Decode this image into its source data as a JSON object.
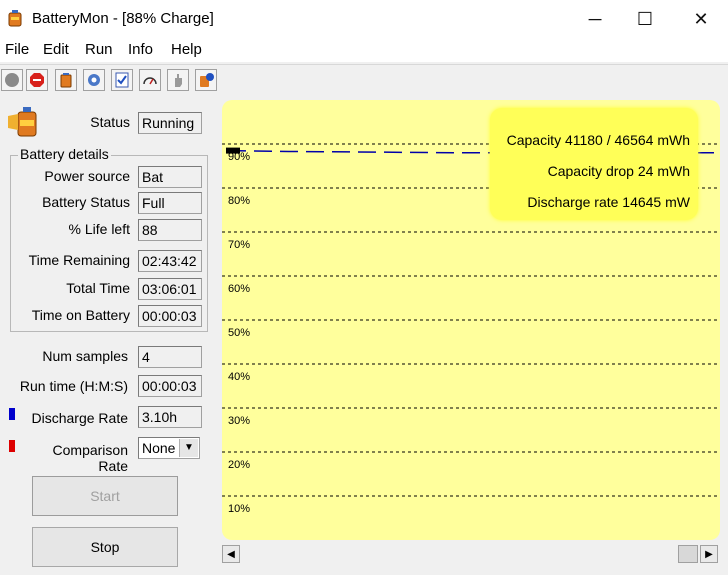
{
  "window": {
    "title": "BatteryMon - [88% Charge]",
    "buttons": {
      "minimize": "─",
      "maximize": "☐",
      "close": "✕"
    }
  },
  "menu": [
    "File",
    "Edit",
    "Run",
    "Info",
    "Help"
  ],
  "toolbar": {
    "icons": [
      "record-icon",
      "stop-icon",
      "battery-icon",
      "settings-icon",
      "checklist-icon",
      "gauge-icon",
      "hand-icon",
      "help-icon"
    ]
  },
  "status": {
    "label": "Status",
    "value": "Running"
  },
  "battery_details": {
    "title": "Battery details",
    "rows": [
      {
        "label": "Power source",
        "value": "Bat"
      },
      {
        "label": "Battery Status",
        "value": "Full"
      },
      {
        "label": "% Life left",
        "value": "88"
      },
      {
        "label": "Time Remaining",
        "value": "02:43:42"
      },
      {
        "label": "Total Time",
        "value": "03:06:01"
      },
      {
        "label": "Time on Battery",
        "value": "00:00:03"
      }
    ]
  },
  "num_samples": {
    "label": "Num samples",
    "value": "4"
  },
  "run_time": {
    "label": "Run time (H:M:S)",
    "value": "00:00:03"
  },
  "discharge_rate": {
    "label": "Discharge Rate",
    "value": "3.10h",
    "marker_color": "#0000cc"
  },
  "comparison_rate": {
    "label": "Comparison Rate",
    "value": "None",
    "marker_color": "#dd0000"
  },
  "buttons": {
    "start": "Start",
    "stop": "Stop"
  },
  "chart": {
    "background": "#ffff9c",
    "overlay": {
      "capacity": "Capacity 41180 / 46564 mWh",
      "capacity_drop": "Capacity drop 24 mWh",
      "discharge_rate": "Discharge rate 14645 mW"
    }
  },
  "chart_data": {
    "type": "line",
    "gridlines": [
      90,
      80,
      70,
      60,
      50,
      40,
      30,
      20,
      10
    ],
    "tick_labels": [
      "90%",
      "80%",
      "70%",
      "60%",
      "50%",
      "40%",
      "30%",
      "20%",
      "10%"
    ],
    "ylim": [
      0,
      100
    ],
    "series": [
      {
        "color": "#0000aa",
        "style": "dashed",
        "values": [
          88.5,
          88.3,
          88.2,
          88.1,
          88.0,
          88.0,
          88.0,
          88.0,
          88.0
        ]
      }
    ]
  }
}
